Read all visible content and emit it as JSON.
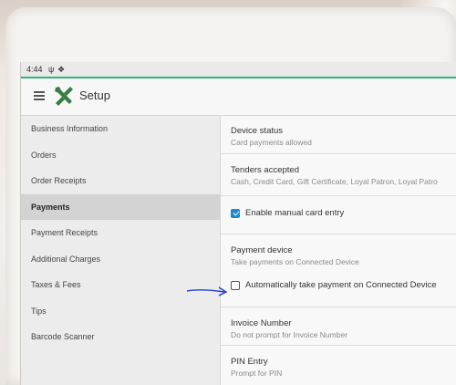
{
  "statusbar": {
    "time": "4:44"
  },
  "toolbar": {
    "title": "Setup"
  },
  "sidebar": {
    "items": [
      {
        "label": "Business Information",
        "active": false
      },
      {
        "label": "Orders",
        "active": false
      },
      {
        "label": "Order Receipts",
        "active": false
      },
      {
        "label": "Payments",
        "active": true
      },
      {
        "label": "Payment Receipts",
        "active": false
      },
      {
        "label": "Additional Charges",
        "active": false
      },
      {
        "label": "Taxes & Fees",
        "active": false
      },
      {
        "label": "Tips",
        "active": false
      },
      {
        "label": "Barcode Scanner",
        "active": false
      }
    ]
  },
  "settings": {
    "device_status": {
      "label": "Device status",
      "value": "Card payments allowed"
    },
    "tenders": {
      "label": "Tenders accepted",
      "value": "Cash, Credit Card, Gift Certificate, Loyal Patron, Loyal Patro"
    },
    "manual_entry": {
      "label": "Enable manual card entry",
      "checked": true
    },
    "payment_device": {
      "label": "Payment device",
      "value": "Take payments on Connected Device"
    },
    "auto_pay": {
      "label": "Automatically take payment on Connected Device",
      "checked": false
    },
    "invoice_number": {
      "label": "Invoice Number",
      "value": "Do not prompt for Invoice Number"
    },
    "pin_entry": {
      "label": "PIN Entry",
      "value": "Prompt for PIN"
    }
  },
  "colors": {
    "accent": "#2bb673",
    "checkbox": "#1e88c8",
    "annotation_arrow": "#1f3fd1"
  }
}
